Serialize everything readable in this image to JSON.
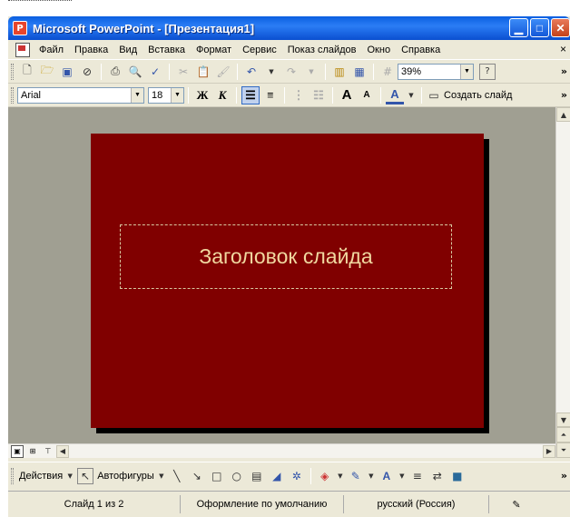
{
  "window": {
    "title": "Microsoft PowerPoint - [Презентация1]",
    "app_icon": "powerpoint-icon"
  },
  "title_buttons": [
    "minimize",
    "maximize",
    "close"
  ],
  "menu": {
    "items": [
      "Файл",
      "Правка",
      "Вид",
      "Вставка",
      "Формат",
      "Сервис",
      "Показ слайдов",
      "Окно",
      "Справка"
    ],
    "close_label": "×"
  },
  "standard_toolbar": {
    "zoom": "39%",
    "help_label": "?",
    "more": "»"
  },
  "formatting_toolbar": {
    "font": "Arial",
    "size": "18",
    "bold": "Ж",
    "italic": "К",
    "new_slide": "Создать слайд",
    "more": "»"
  },
  "slide": {
    "title": "Заголовок слайда",
    "background_color": "#800000",
    "title_color": "#f0d8a0"
  },
  "drawing_toolbar": {
    "actions": "Действия",
    "autoshapes": "Автофигуры",
    "more": "»"
  },
  "status": {
    "slide": "Слайд 1 из 2",
    "design": "Оформление по умолчанию",
    "language": "русский (Россия)"
  }
}
